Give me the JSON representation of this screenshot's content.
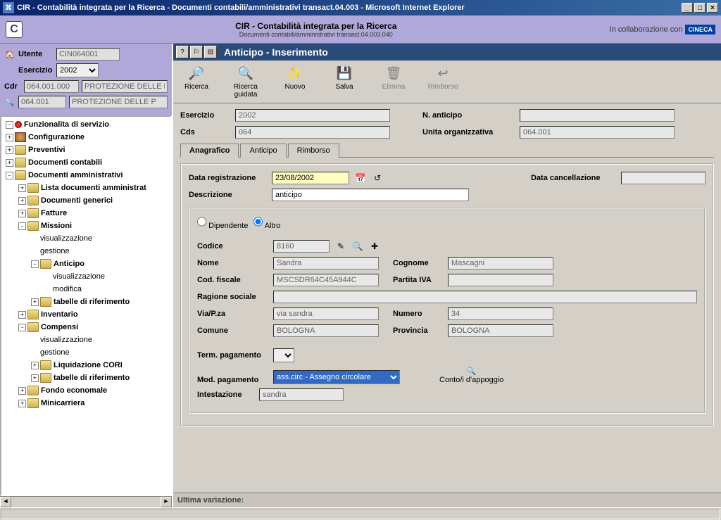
{
  "window": {
    "title": "CIR - Contabilità integrata per la Ricerca - Documenti contabili/amministrativi transact.04.003 - Microsoft Internet Explorer"
  },
  "header": {
    "title": "CIR - Contabilità integrata per la Ricerca",
    "subtitle": "Documenti contabili/amministrativi transact.04.003.040",
    "collab": "In collaborazione con",
    "brand": "CINECA"
  },
  "left": {
    "utente_lbl": "Utente",
    "utente_val": "CIN064001",
    "esercizio_lbl": "Esercizio",
    "esercizio_val": "2002",
    "cdr_lbl": "Cdr",
    "cdr_code": "064.001.000",
    "cdr_desc": "PROTEZIONE DELLE P",
    "bino_code": "064.001",
    "bino_desc": "PROTEZIONE DELLE P"
  },
  "tree": [
    {
      "d": 0,
      "exp": "-",
      "ico": "red",
      "label": "Funzionalita di servizio",
      "leaf": false
    },
    {
      "d": 0,
      "exp": "+",
      "ico": "gear",
      "label": "Configurazione",
      "leaf": false
    },
    {
      "d": 0,
      "exp": "+",
      "ico": "fld",
      "label": "Preventivi",
      "leaf": false
    },
    {
      "d": 0,
      "exp": "+",
      "ico": "fld",
      "label": "Documenti contabili",
      "leaf": false
    },
    {
      "d": 0,
      "exp": "-",
      "ico": "fld",
      "label": "Documenti amministrativi",
      "leaf": false
    },
    {
      "d": 1,
      "exp": "+",
      "ico": "fld",
      "label": "Lista documenti amministrat",
      "leaf": false
    },
    {
      "d": 1,
      "exp": "+",
      "ico": "fld",
      "label": "Documenti generici",
      "leaf": false
    },
    {
      "d": 1,
      "exp": "+",
      "ico": "fld",
      "label": "Fatture",
      "leaf": false
    },
    {
      "d": 1,
      "exp": "-",
      "ico": "fld",
      "label": "Missioni",
      "leaf": false
    },
    {
      "d": 2,
      "exp": "",
      "ico": "",
      "label": "visualizzazione",
      "leaf": true
    },
    {
      "d": 2,
      "exp": "",
      "ico": "",
      "label": "gestione",
      "leaf": true
    },
    {
      "d": 2,
      "exp": "-",
      "ico": "fld",
      "label": "Anticipo",
      "leaf": false
    },
    {
      "d": 3,
      "exp": "",
      "ico": "",
      "label": "visualizzazione",
      "leaf": true
    },
    {
      "d": 3,
      "exp": "",
      "ico": "",
      "label": "modifica",
      "leaf": true
    },
    {
      "d": 2,
      "exp": "+",
      "ico": "fld",
      "label": "tabelle di riferimento",
      "leaf": false
    },
    {
      "d": 1,
      "exp": "+",
      "ico": "fld",
      "label": "Inventario",
      "leaf": false
    },
    {
      "d": 1,
      "exp": "-",
      "ico": "fld",
      "label": "Compensi",
      "leaf": false
    },
    {
      "d": 2,
      "exp": "",
      "ico": "",
      "label": "visualizzazione",
      "leaf": true
    },
    {
      "d": 2,
      "exp": "",
      "ico": "",
      "label": "gestione",
      "leaf": true
    },
    {
      "d": 2,
      "exp": "+",
      "ico": "fld",
      "label": "Liquidazione CORI",
      "leaf": false
    },
    {
      "d": 2,
      "exp": "+",
      "ico": "fld",
      "label": "tabelle di riferimento",
      "leaf": false
    },
    {
      "d": 1,
      "exp": "+",
      "ico": "fld",
      "label": "Fondo economale",
      "leaf": false
    },
    {
      "d": 1,
      "exp": "+",
      "ico": "fld",
      "label": "Minicarriera",
      "leaf": false
    }
  ],
  "inner": {
    "title": "Anticipo - Inserimento",
    "toolbar": {
      "ricerca": "Ricerca",
      "ricerca_guidata": "Ricerca guidata",
      "nuovo": "Nuovo",
      "salva": "Salva",
      "elimina": "Elimina",
      "rimborso": "Rimborso"
    },
    "fields": {
      "esercizio_lbl": "Esercizio",
      "esercizio_val": "2002",
      "nanticipo_lbl": "N. anticipo",
      "nanticipo_val": "",
      "cds_lbl": "Cds",
      "cds_val": "064",
      "uo_lbl": "Unita organizzativa",
      "uo_val": "064.001"
    },
    "tabs": {
      "anagrafico": "Anagrafico",
      "anticipo": "Anticipo",
      "rimborso": "Rimborso"
    },
    "anag": {
      "data_reg_lbl": "Data registrazione",
      "data_reg_val": "23/08/2002",
      "data_canc_lbl": "Data cancellazione",
      "data_canc_val": "",
      "descr_lbl": "Descrizione",
      "descr_val": "anticipo",
      "radio_dip": "Dipendente",
      "radio_altro": "Altro",
      "codice_lbl": "Codice",
      "codice_val": "8160",
      "nome_lbl": "Nome",
      "nome_val": "Sandra",
      "cognome_lbl": "Cognome",
      "cognome_val": "Mascagni",
      "cf_lbl": "Cod. fiscale",
      "cf_val": "MSCSDR64C45A944C",
      "piva_lbl": "Partita IVA",
      "piva_val": "",
      "ragsoc_lbl": "Ragione sociale",
      "ragsoc_val": "",
      "via_lbl": "Via/P.za",
      "via_val": "via sandra",
      "numero_lbl": "Numero",
      "numero_val": "34",
      "comune_lbl": "Comune",
      "comune_val": "BOLOGNA",
      "prov_lbl": "Provincia",
      "prov_val": "BOLOGNA",
      "termpag_lbl": "Term. pagamento",
      "modpag_lbl": "Mod. pagamento",
      "modpag_val": "ass.circ - Assegno circolare",
      "conto_lbl": "Conto/i d'appoggio",
      "intest_lbl": "Intestazione",
      "intest_val": "sandra"
    },
    "ultima": "Ultima variazione:"
  }
}
